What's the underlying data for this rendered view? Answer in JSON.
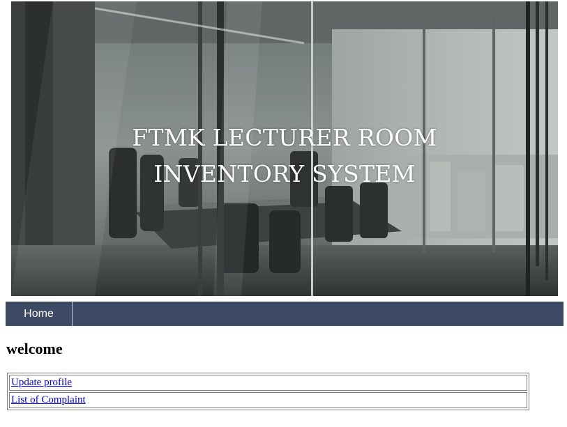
{
  "banner": {
    "title_line1": "FTMK LECTURER ROOM",
    "title_line2": "INVENTORY SYSTEM",
    "image_subject": "conference-room-photo"
  },
  "nav": {
    "items": [
      {
        "label": "Home"
      }
    ],
    "background_color": "#3c4a63"
  },
  "main": {
    "heading": "welcome",
    "links": [
      {
        "label": "Update profile"
      },
      {
        "label": "List of Complaint"
      }
    ],
    "link_color": "#0000ee"
  }
}
